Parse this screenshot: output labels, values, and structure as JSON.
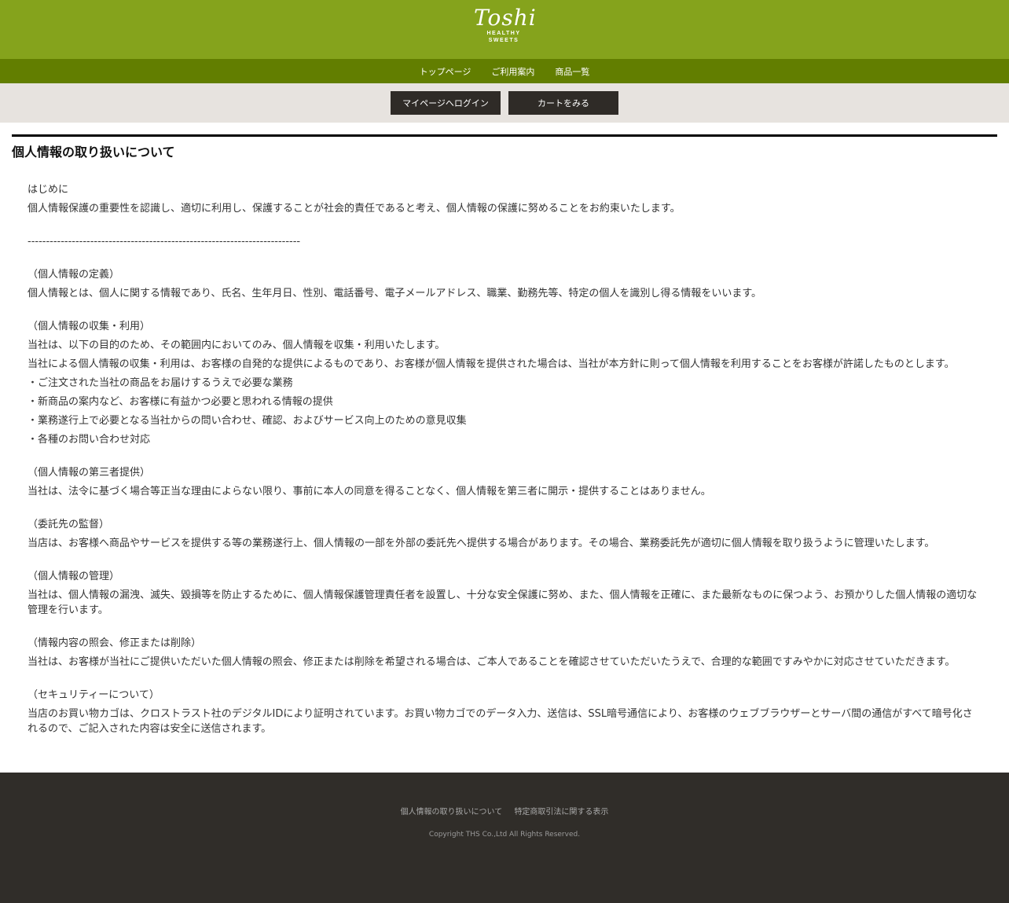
{
  "header": {
    "logo_script": "Toshi",
    "logo_line1": "HEALTHY",
    "logo_line2": "SWEETS"
  },
  "nav": {
    "items": [
      {
        "label": "トップページ"
      },
      {
        "label": "ご利用案内"
      },
      {
        "label": "商品一覧"
      }
    ]
  },
  "account_bar": {
    "login_label": "マイページへログイン",
    "cart_label": "カートをみる"
  },
  "page": {
    "title": "個人情報の取り扱いについて",
    "intro_heading": "はじめに",
    "intro_text": "個人情報保護の重要性を認識し、適切に利用し、保護することが社会的責任であると考え、個人情報の保護に努めることをお約束いたします。",
    "divider_text": "--------------------------------------------------------------------------",
    "sections": [
      {
        "heading": "（個人情報の定義）",
        "lines": [
          "個人情報とは、個人に関する情報であり、氏名、生年月日、性別、電話番号、電子メールアドレス、職業、勤務先等、特定の個人を識別し得る情報をいいます。"
        ]
      },
      {
        "heading": "（個人情報の収集・利用）",
        "lines": [
          "当社は、以下の目的のため、その範囲内においてのみ、個人情報を収集・利用いたします。",
          "当社による個人情報の収集・利用は、お客様の自発的な提供によるものであり、お客様が個人情報を提供された場合は、当社が本方針に則って個人情報を利用することをお客様が許諾したものとします。",
          "・ご注文された当社の商品をお届けするうえで必要な業務",
          "・新商品の案内など、お客様に有益かつ必要と思われる情報の提供",
          "・業務遂行上で必要となる当社からの問い合わせ、確認、およびサービス向上のための意見収集",
          "・各種のお問い合わせ対応"
        ]
      },
      {
        "heading": "（個人情報の第三者提供）",
        "lines": [
          "当社は、法令に基づく場合等正当な理由によらない限り、事前に本人の同意を得ることなく、個人情報を第三者に開示・提供することはありません。"
        ]
      },
      {
        "heading": "（委託先の監督）",
        "lines": [
          "当店は、お客様へ商品やサービスを提供する等の業務遂行上、個人情報の一部を外部の委託先へ提供する場合があります。その場合、業務委託先が適切に個人情報を取り扱うように管理いたします。"
        ]
      },
      {
        "heading": "（個人情報の管理）",
        "lines": [
          "当社は、個人情報の漏洩、滅失、毀損等を防止するために、個人情報保護管理責任者を設置し、十分な安全保護に努め、また、個人情報を正確に、また最新なものに保つよう、お預かりした個人情報の適切な管理を行います。"
        ]
      },
      {
        "heading": "（情報内容の照会、修正または削除）",
        "lines": [
          "当社は、お客様が当社にご提供いただいた個人情報の照会、修正または削除を希望される場合は、ご本人であることを確認させていただいたうえで、合理的な範囲ですみやかに対応させていただきます。"
        ]
      },
      {
        "heading": "（セキュリティーについて）",
        "lines": [
          "当店のお買い物カゴは、クロストラスト社のデジタルIDにより証明されています。お買い物カゴでのデータ入力、送信は、SSL暗号通信により、お客様のウェブブラウザーとサーバ間の通信がすべて暗号化されるので、ご記入された内容は安全に送信されます。"
        ]
      }
    ]
  },
  "footer": {
    "links": [
      {
        "label": "個人情報の取り扱いについて"
      },
      {
        "label": "特定商取引法に関する表示"
      }
    ],
    "copyright": "Copyright THS Co.,Ltd All Rights Reserved."
  },
  "colors": {
    "header_green": "#85a31c",
    "nav_green": "#627e00",
    "button_band": "#e7e3df",
    "dark_button": "#2f2b27",
    "footer_bg": "#302d29"
  }
}
